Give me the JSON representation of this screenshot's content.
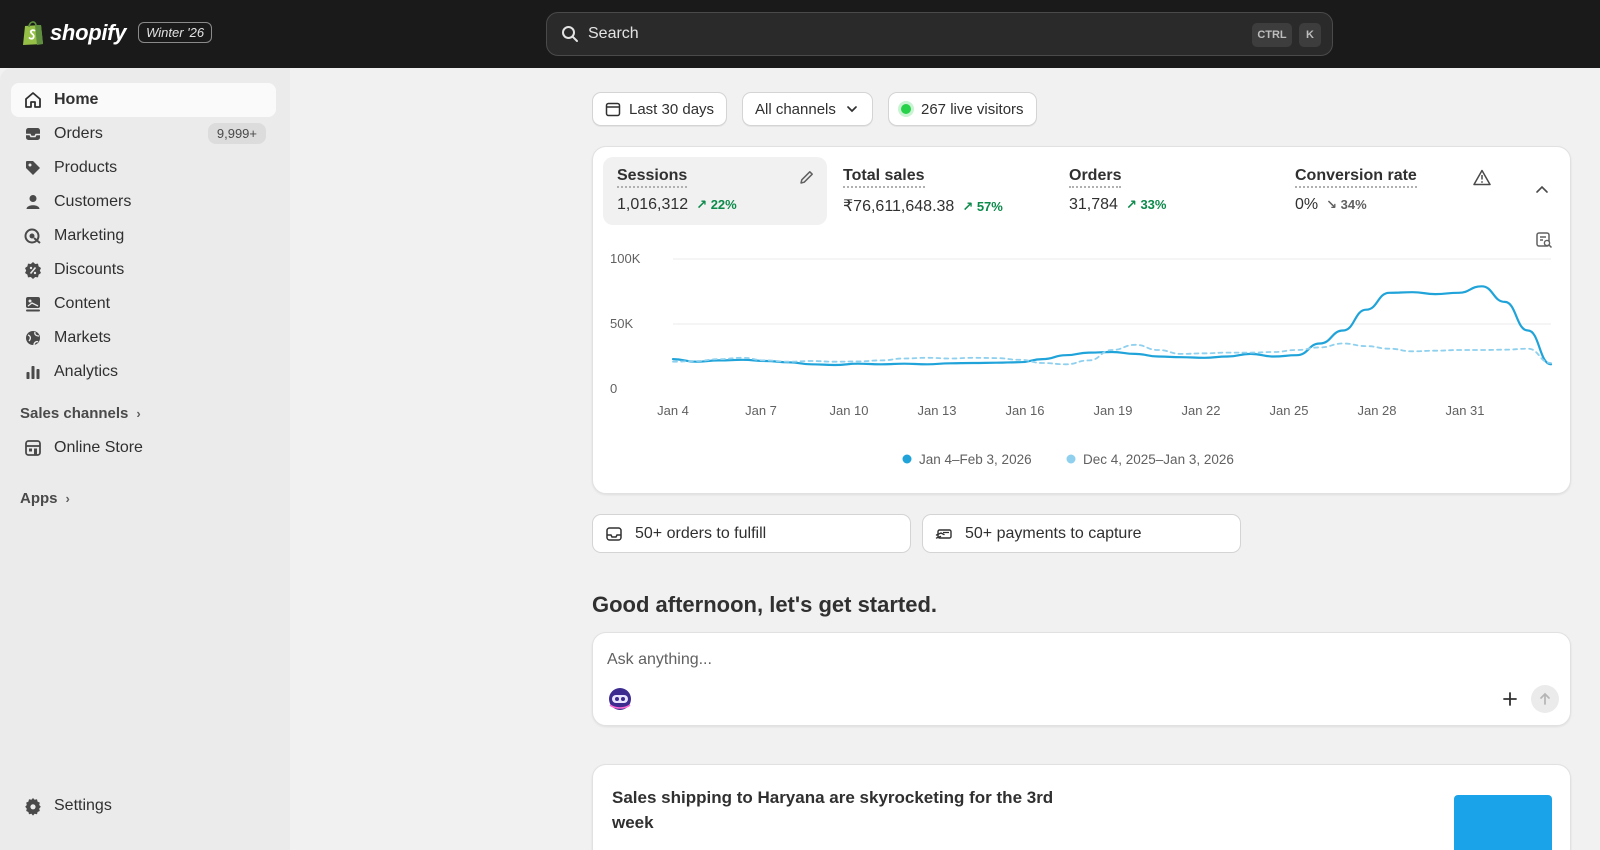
{
  "topbar": {
    "brand": "shopify",
    "edition": "Winter '26",
    "search_placeholder": "Search",
    "shortcut_keys": [
      "CTRL",
      "K"
    ]
  },
  "sidebar": {
    "items": [
      {
        "label": "Home",
        "icon": "home-icon"
      },
      {
        "label": "Orders",
        "icon": "inbox-icon",
        "badge": "9,999+"
      },
      {
        "label": "Products",
        "icon": "tag-icon"
      },
      {
        "label": "Customers",
        "icon": "person-icon"
      },
      {
        "label": "Marketing",
        "icon": "target-icon"
      },
      {
        "label": "Discounts",
        "icon": "discount-icon"
      },
      {
        "label": "Content",
        "icon": "content-icon"
      },
      {
        "label": "Markets",
        "icon": "globe-icon"
      },
      {
        "label": "Analytics",
        "icon": "bar-chart-icon"
      }
    ],
    "sales_channels_label": "Sales channels",
    "online_store_label": "Online Store",
    "apps_label": "Apps",
    "settings_label": "Settings"
  },
  "filters": {
    "date_range": "Last 30 days",
    "channels": "All channels",
    "live_visitors": "267 live visitors"
  },
  "metrics": [
    {
      "label": "Sessions",
      "value": "1,016,312",
      "change": "22%",
      "direction": "up"
    },
    {
      "label": "Total sales",
      "value": "₹76,611,648.38",
      "change": "57%",
      "direction": "up"
    },
    {
      "label": "Orders",
      "value": "31,784",
      "change": "33%",
      "direction": "up"
    },
    {
      "label": "Conversion rate",
      "value": "0%",
      "change": "34%",
      "direction": "down"
    }
  ],
  "chart_data": {
    "type": "line",
    "y_ticks": [
      "100K",
      "50K",
      "0"
    ],
    "ylim": [
      0,
      100000
    ],
    "x_ticks": [
      "Jan 4",
      "Jan 7",
      "Jan 10",
      "Jan 13",
      "Jan 16",
      "Jan 19",
      "Jan 22",
      "Jan 25",
      "Jan 28",
      "Jan 31"
    ],
    "series": [
      {
        "name": "Jan 4–Feb 3, 2026",
        "color": "#1fa3d9",
        "style": "solid",
        "values": [
          23000,
          21000,
          22000,
          22500,
          21500,
          20500,
          19000,
          18500,
          19500,
          19000,
          19500,
          19000,
          19800,
          20000,
          20200,
          20600,
          23000,
          26000,
          28000,
          28500,
          27000,
          25000,
          24500,
          24000,
          25000,
          27000,
          25000,
          26000,
          35000,
          45000,
          61000,
          74000,
          74500,
          73000,
          74000,
          79000,
          67000,
          45000,
          19000
        ]
      },
      {
        "name": "Dec 4, 2025–Jan 3, 2026",
        "color": "#8fd0ee",
        "style": "dashed",
        "values": [
          21000,
          21500,
          23000,
          24000,
          22000,
          21000,
          21500,
          21000,
          21200,
          22000,
          23500,
          24000,
          23500,
          24000,
          23800,
          22500,
          20000,
          19000,
          22000,
          30000,
          34000,
          30000,
          27000,
          27500,
          28000,
          28000,
          28500,
          30000,
          32000,
          35000,
          33000,
          31000,
          29000,
          29500,
          30000,
          30000,
          30200,
          31000,
          20000
        ]
      }
    ],
    "legend": [
      "Jan 4–Feb 3, 2026",
      "Dec 4, 2025–Jan 3, 2026"
    ]
  },
  "tasks": [
    {
      "label": "50+ orders to fulfill",
      "icon": "inbox-icon"
    },
    {
      "label": "50+ payments to capture",
      "icon": "payment-icon"
    }
  ],
  "greeting": "Good afternoon, let's get started.",
  "assistant": {
    "placeholder": "Ask anything..."
  },
  "insight": {
    "title": "Sales shipping to Haryana are skyrocketing for the 3rd week",
    "accent_color": "#1aa3e8"
  }
}
